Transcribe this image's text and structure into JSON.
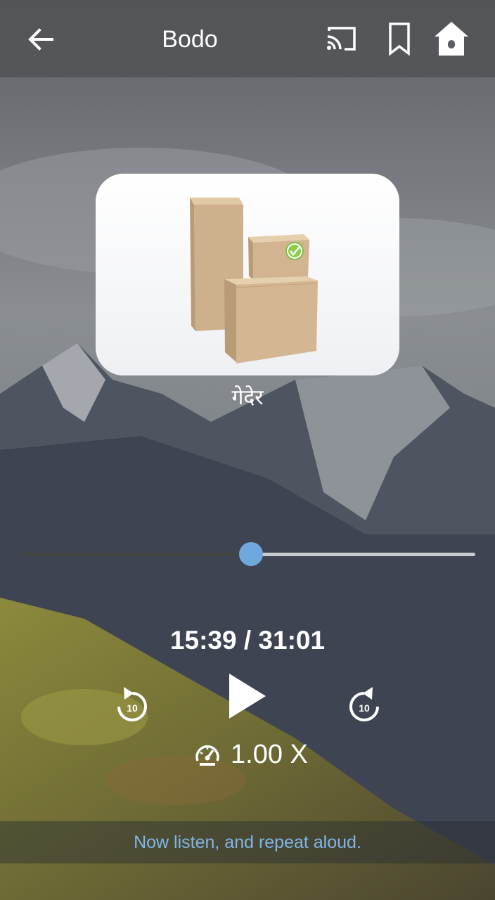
{
  "app": {
    "title": "Bodo"
  },
  "header": {
    "back_icon": "arrow-left-icon",
    "cast_icon": "cast-icon",
    "bookmark_icon": "bookmark-icon",
    "home_icon": "home-icon"
  },
  "card": {
    "image": "cardboard-boxes-picture"
  },
  "lesson": {
    "word": "गेदेर"
  },
  "player": {
    "progress": 0.504,
    "time": "15:39 / 31:01",
    "rewind_icon": "rewind-10-icon",
    "rewind_value": "10",
    "play_icon": "play-icon",
    "forward_icon": "forward-10-icon",
    "forward_value": "10",
    "speed_icon": "speedometer-icon",
    "speed": "1.00 X"
  },
  "footer": {
    "instruction": "Now listen, and repeat aloud."
  },
  "colors": {
    "accent": "#6fa8dc",
    "instruction_text": "#7fb6e6"
  }
}
